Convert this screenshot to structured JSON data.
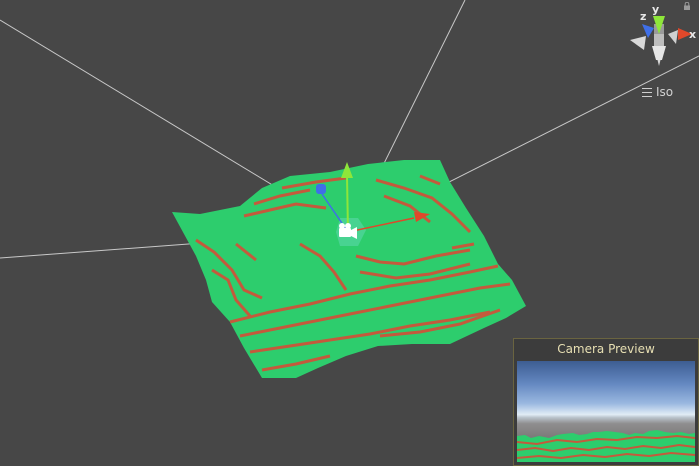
{
  "scene": {
    "projection_label": "Iso",
    "gizmo": {
      "x_label": "x",
      "y_label": "y",
      "z_label": "z"
    },
    "colors": {
      "background": "#474747",
      "terrain_green": "#2dcd6d",
      "terrain_stripe": "#c45a3c",
      "frustum_line": "#c8c8c8",
      "axis_y": "#8ee63a",
      "axis_x": "#e0482a",
      "axis_z": "#3f6fe8"
    }
  },
  "camera_preview": {
    "title": "Camera Preview"
  },
  "icons": [
    "lock-icon",
    "menu-icon",
    "camera-icon",
    "move-tool-icon"
  ]
}
